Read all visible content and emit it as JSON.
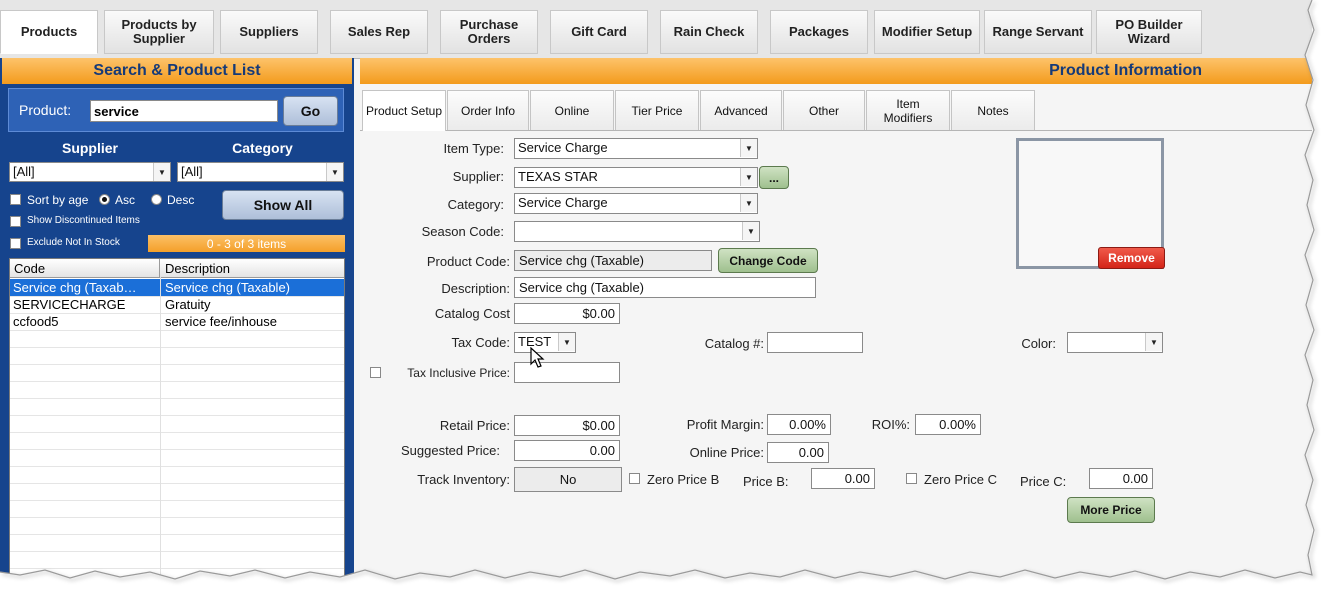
{
  "nav": {
    "tabs": [
      {
        "label": "Products",
        "active": true
      },
      {
        "label": "Products by Supplier"
      },
      {
        "label": "Suppliers"
      },
      {
        "label": "Sales Rep"
      },
      {
        "label": "Purchase Orders"
      },
      {
        "label": "Gift Card"
      },
      {
        "label": "Rain Check"
      },
      {
        "label": "Packages"
      },
      {
        "label": "Modifier Setup"
      },
      {
        "label": "Range Servant"
      },
      {
        "label": "PO Builder Wizard"
      }
    ]
  },
  "search_panel": {
    "title": "Search & Product List",
    "product_label": "Product:",
    "product_value": "service",
    "go_label": "Go",
    "supplier_label": "Supplier",
    "category_label": "Category",
    "supplier_value": "[All]",
    "category_value": "[All]",
    "sort_by_age_label": "Sort by age",
    "asc_label": "Asc",
    "desc_label": "Desc",
    "show_all_label": "Show All",
    "show_discontinued_label": "Show Discontinued Items",
    "exclude_not_in_stock_label": "Exclude Not In Stock",
    "items_count": "0 - 3 of 3 items",
    "columns": [
      "Code",
      "Description"
    ],
    "rows": [
      {
        "code": "Service chg (Taxab…",
        "description": "Service chg (Taxable)",
        "selected": true
      },
      {
        "code": "SERVICECHARGE",
        "description": "Gratuity"
      },
      {
        "code": "ccfood5",
        "description": "service fee/inhouse"
      }
    ]
  },
  "product_panel": {
    "title": "Product Information",
    "tabs": [
      {
        "label": "Product Setup",
        "active": true
      },
      {
        "label": "Order Info"
      },
      {
        "label": "Online"
      },
      {
        "label": "Tier Price"
      },
      {
        "label": "Advanced"
      },
      {
        "label": "Other"
      },
      {
        "label": "Item Modifiers"
      },
      {
        "label": "Notes"
      }
    ],
    "fields": {
      "item_type_label": "Item Type:",
      "item_type_value": "Service Charge",
      "supplier_label": "Supplier:",
      "supplier_value": "TEXAS STAR",
      "supplier_more": "...",
      "category_label": "Category:",
      "category_value": "Service Charge",
      "season_code_label": "Season Code:",
      "season_code_value": "",
      "product_code_label": "Product Code:",
      "product_code_value": "Service chg (Taxable)",
      "change_code_label": "Change Code",
      "description_label": "Description:",
      "description_value": "Service chg (Taxable)",
      "catalog_cost_label": "Catalog Cost",
      "catalog_cost_value": "$0.00",
      "tax_code_label": "Tax Code:",
      "tax_code_value": "TEST",
      "catalog_num_label": "Catalog #:",
      "catalog_num_value": "",
      "color_label": "Color:",
      "color_value": "",
      "tax_inclusive_label": "Tax Inclusive Price:",
      "tax_inclusive_value": "",
      "retail_price_label": "Retail Price:",
      "retail_price_value": "$0.00",
      "profit_margin_label": "Profit Margin:",
      "profit_margin_value": "0.00%",
      "roi_label": "ROI%:",
      "roi_value": "0.00%",
      "suggested_price_label": "Suggested Price:",
      "suggested_price_value": "0.00",
      "online_price_label": "Online Price:",
      "online_price_value": "0.00",
      "track_inventory_label": "Track Inventory:",
      "track_inventory_value": "No",
      "zero_price_b_label": "Zero Price B",
      "price_b_label": "Price B:",
      "price_b_value": "0.00",
      "zero_price_c_label": "Zero Price C",
      "price_c_label": "Price C:",
      "price_c_value": "0.00",
      "more_price_label": "More Price",
      "remove_label": "Remove"
    }
  }
}
